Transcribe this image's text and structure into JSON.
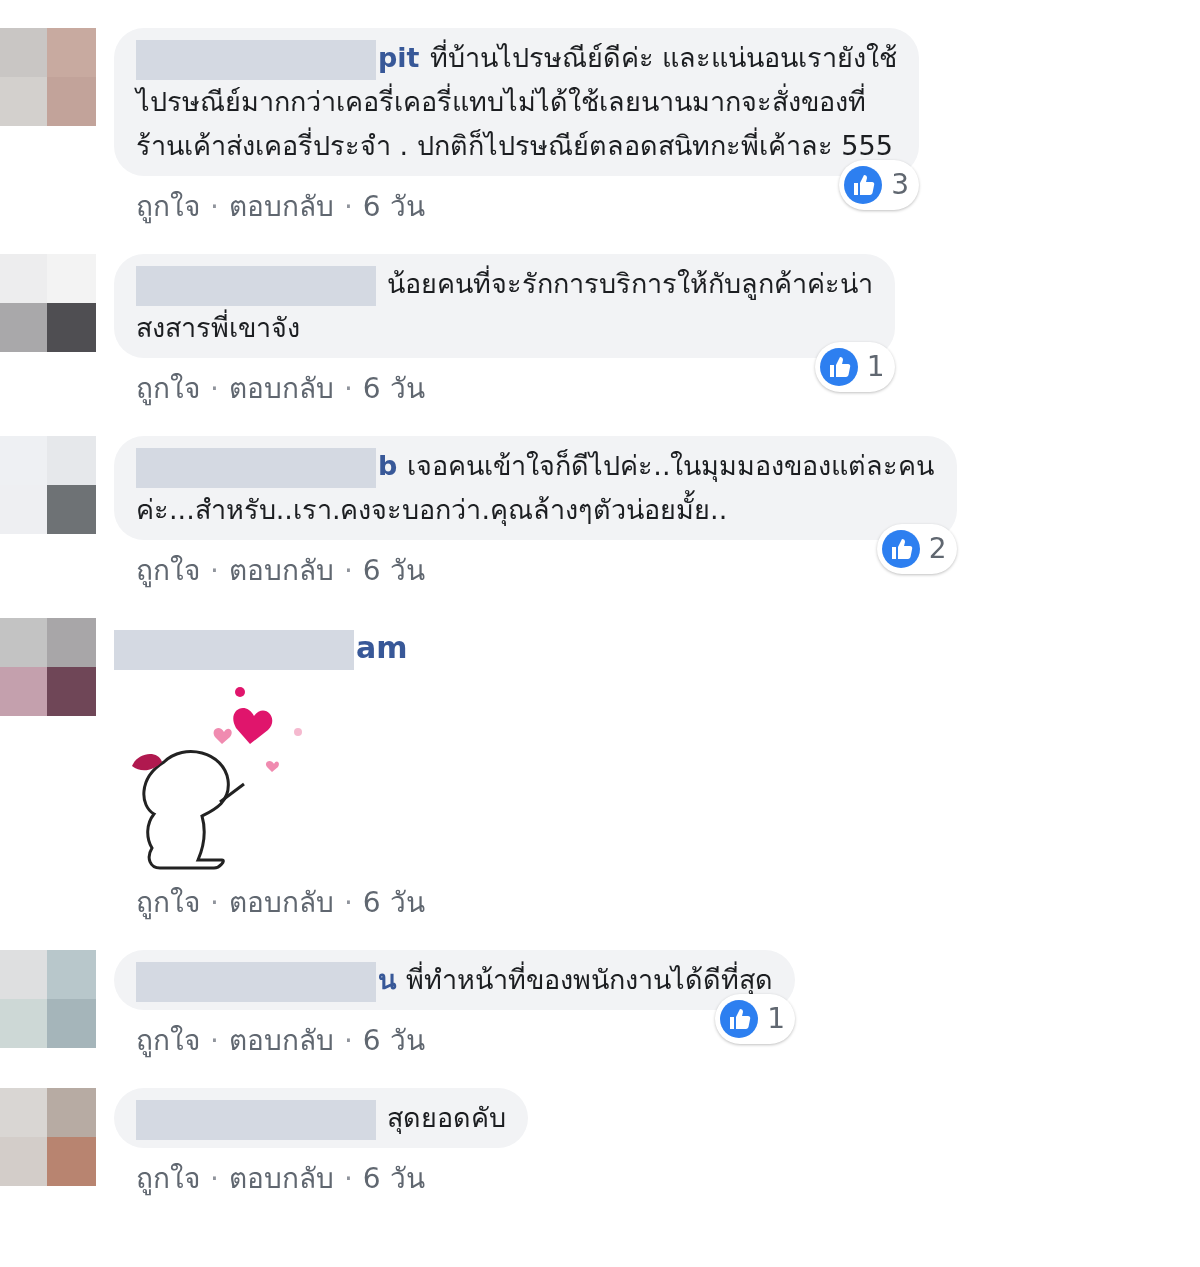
{
  "comments": [
    {
      "name": "pit",
      "lines": [
        "ที่บ้านไปรษณีย์ดีค่ะ และแน่นอนเรายังใช้",
        "ไปรษณีย์มากกว่าเคอรี่เคอรี่แทบไม่ได้ใช้เลยนานมากจะสั่งของที่",
        "ร้านเค้าส่งเคอรี่ประจำ . ปกติก็ไปรษณีย์ตลอดสนิทกะพี่เค้าละ 555"
      ],
      "likes": "3",
      "meta": [
        {
          "kind": "link",
          "text": "ถูกใจ"
        },
        {
          "kind": "sep",
          "text": "·"
        },
        {
          "kind": "link",
          "text": "ตอบกลับ"
        },
        {
          "kind": "sep",
          "text": "·"
        },
        {
          "kind": "time",
          "text": "6 วัน"
        }
      ]
    },
    {
      "lines": [
        "น้อยคนที่จะรักการบริการให้กับลูกค้าค่ะน่า",
        "สงสารพี่เขาจัง"
      ],
      "likes": "1",
      "meta": [
        {
          "kind": "link",
          "text": "ถูกใจ"
        },
        {
          "kind": "sep",
          "text": "·"
        },
        {
          "kind": "link",
          "text": "ตอบกลับ"
        },
        {
          "kind": "sep",
          "text": "·"
        },
        {
          "kind": "time",
          "text": "6 วัน"
        }
      ]
    },
    {
      "name": "b",
      "lines": [
        "เจอคนเข้าใจก็ดีไปค่ะ..ในมุมมองของแต่ละคน",
        "ค่ะ...สำหรับ..เรา.คงจะบอกว่า.คุณล้างๆตัวน่อยมั้ย.."
      ],
      "likes": "2",
      "meta": [
        {
          "kind": "link",
          "text": "ถูกใจ"
        },
        {
          "kind": "sep",
          "text": "·"
        },
        {
          "kind": "link",
          "text": "ตอบกลับ"
        },
        {
          "kind": "sep",
          "text": "·"
        },
        {
          "kind": "time",
          "text": "6 วัน"
        }
      ]
    },
    {
      "name": "am",
      "attachment": {
        "kind": "sticker"
      },
      "meta": [
        {
          "kind": "link",
          "text": "ถูกใจ"
        },
        {
          "kind": "sep",
          "text": "·"
        },
        {
          "kind": "link",
          "text": "ตอบกลับ"
        },
        {
          "kind": "sep",
          "text": "·"
        },
        {
          "kind": "time",
          "text": "6 วัน"
        }
      ]
    },
    {
      "name": "น",
      "lines": [
        "พี่ทำหน้าที่ของพนักงานได้ดีที่สุด"
      ],
      "likes": "1",
      "meta": [
        {
          "kind": "link",
          "text": "ถูกใจ"
        },
        {
          "kind": "sep",
          "text": "·"
        },
        {
          "kind": "link",
          "text": "ตอบกลับ"
        },
        {
          "kind": "sep",
          "text": "·"
        },
        {
          "kind": "time",
          "text": "6 วัน"
        }
      ]
    },
    {
      "lines": [
        "สุดยอดคับ"
      ],
      "meta": [
        {
          "kind": "link",
          "text": "ถูกใจ"
        },
        {
          "kind": "sep",
          "text": "·"
        },
        {
          "kind": "link",
          "text": "ตอบกลับ"
        },
        {
          "kind": "sep",
          "text": "·"
        },
        {
          "kind": "time",
          "text": "6 วัน"
        }
      ]
    }
  ]
}
